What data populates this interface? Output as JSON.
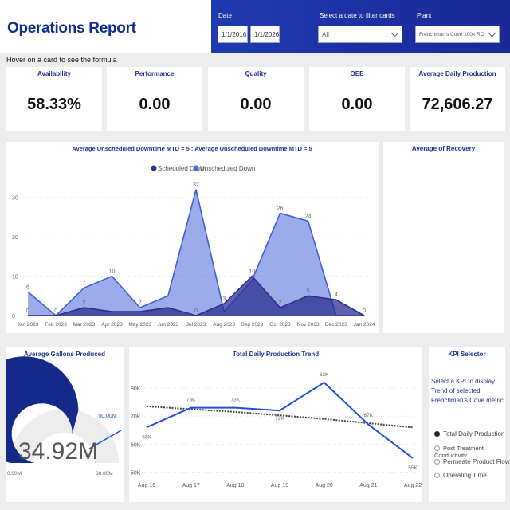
{
  "header": {
    "title": "Operations Report",
    "date_label": "Date",
    "date_start": "1/1/2016",
    "date_end": "1/1/2026",
    "filter_label": "Select a date to filter cards",
    "filter_value": "All",
    "plant_label": "Plant",
    "plant_value": "Frenchman's Cove 100k RO"
  },
  "hint": "Hover on a card to see the formula",
  "cards": [
    {
      "title": "Availability",
      "value": "58.33%"
    },
    {
      "title": "Performance",
      "value": "0.00"
    },
    {
      "title": "Quality",
      "value": "0.00"
    },
    {
      "title": "OEE",
      "value": "0.00"
    },
    {
      "title": "Average Daily Production",
      "value": "72,606.27"
    }
  ],
  "recovery": {
    "title": "Average of Recovery"
  },
  "gallons": {
    "title": "Average Gallons Produced",
    "value_text": "34.92M",
    "min_label": "0.00M",
    "max_label": "60.00M",
    "target_label": "50.00M",
    "value": 34.92,
    "min": 0,
    "max": 60,
    "target": 50
  },
  "kpi": {
    "title": "KPI Selector",
    "description": "Select a KPI to display Trend of selected Frenchman's Cove metric.",
    "options": [
      "Total Daily Production",
      "Post Treatment Conductivity",
      "Permeate Product Flow",
      "Operating Time"
    ],
    "selected": 0
  },
  "chart_data": [
    {
      "type": "area",
      "title": "Average Unscheduled Downtime MTD = 5 : Average Unscheduled Downtime MTD = 5",
      "legend_position": "top",
      "categories": [
        "Jan 2023",
        "Feb 2023",
        "Mar 2023",
        "Apr 2023",
        "May 2023",
        "Jun 2023",
        "Jul 2023",
        "Aug 2023",
        "Sep 2023",
        "Oct 2023",
        "Nov 2023",
        "Dec 2023",
        "Jan 2024"
      ],
      "series": [
        {
          "name": "Scheduled Down",
          "color": "#2b2f8f",
          "values": [
            0,
            0,
            2,
            1,
            1,
            2,
            0,
            3,
            10,
            2,
            5,
            4,
            0
          ]
        },
        {
          "name": "Unscheduled Down",
          "color": "#4a68d8",
          "values": [
            6,
            0,
            7,
            10,
            2,
            5,
            32,
            1,
            9,
            26,
            24,
            0,
            0
          ]
        }
      ],
      "labels": [
        {
          "x": 0,
          "value": 6,
          "text": "6"
        },
        {
          "x": 1,
          "value": 0,
          "text": "0"
        },
        {
          "x": 2,
          "value": 7,
          "text": "7"
        },
        {
          "x": 3,
          "value": 10,
          "text": "10"
        },
        {
          "x": 4,
          "value": 2,
          "text": "2"
        },
        {
          "x": 6,
          "value": 32,
          "text": "32"
        },
        {
          "x": 7,
          "value": 3,
          "text": "3"
        },
        {
          "x": 8,
          "value": 10,
          "text": "10"
        },
        {
          "x": 9,
          "value": 26,
          "text": "26"
        },
        {
          "x": 10,
          "value": 24,
          "text": "24"
        },
        {
          "x": 10,
          "value": 5,
          "text": "5"
        },
        {
          "x": 11,
          "value": 4,
          "text": "4"
        },
        {
          "x": 12,
          "value": 0,
          "text": "0"
        },
        {
          "x": 0,
          "value": 0,
          "text": "0"
        },
        {
          "x": 2,
          "value": 2,
          "text": "2"
        },
        {
          "x": 3,
          "value": 1,
          "text": "1"
        },
        {
          "x": 6,
          "value": 0,
          "text": "0"
        },
        {
          "x": 9,
          "value": 2,
          "text": "2"
        }
      ],
      "yticks": [
        0,
        10,
        20,
        30
      ],
      "ylim": [
        0,
        35
      ]
    },
    {
      "type": "line",
      "title": "Total Daily Production Trend",
      "categories": [
        "Aug 16",
        "Aug 17",
        "Aug 18",
        "Aug 19",
        "Aug 20",
        "Aug 21",
        "Aug 22"
      ],
      "values": [
        66000,
        73000,
        73000,
        72000,
        82000,
        67000,
        55000
      ],
      "value_labels": [
        "66K",
        "73K",
        "73K",
        "72K",
        "82K",
        "67K",
        "55K"
      ],
      "trend": [
        73500,
        72500,
        71500,
        70300,
        69000,
        67500,
        66000
      ],
      "yticks": [
        50000,
        60000,
        70000,
        80000
      ],
      "ytick_labels": [
        "50K",
        "60K",
        "70K",
        "80K"
      ],
      "ylim": [
        49000,
        86000
      ],
      "color": "#1a4fd6"
    }
  ]
}
